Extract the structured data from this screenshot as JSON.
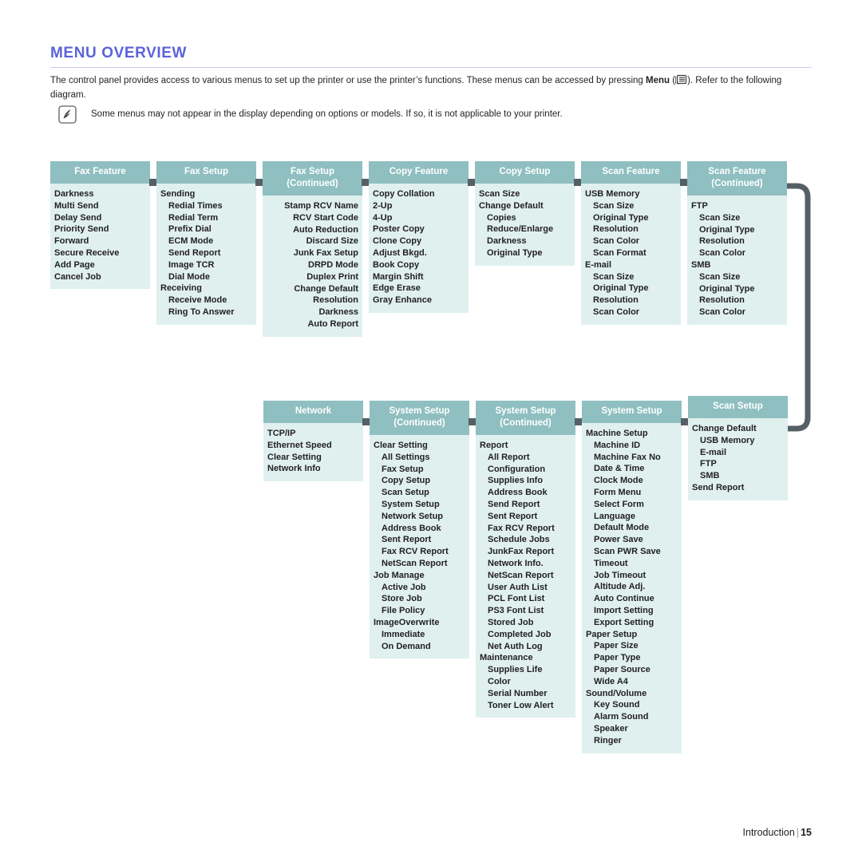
{
  "page": {
    "title": "Menu Overview",
    "intro_part1": "The control panel provides access to various menus to set up the printer or use the printer’s functions. These menus can be accessed by pressing ",
    "intro_bold": "Menu",
    "intro_part2": " (",
    "intro_part3": "). Refer to the following diagram.",
    "note_text": "Some menus may not appear in the display depending on options or models. If so, it is not applicable to your printer.",
    "note_icon": "note-pencil-icon",
    "menu_icon": "menu-key-icon",
    "footer_label": "Introduction",
    "footer_separator": "|",
    "footer_page": "15"
  },
  "colors": {
    "header_teal": "#8fbfc0",
    "body_mint": "#dff0ef",
    "connector_gray": "#556066",
    "title_blue": "#5b63d8"
  },
  "diagram": {
    "row1": [
      {
        "title": "Fax Feature",
        "subtitle": "",
        "align": "left",
        "items": [
          {
            "label": "Darkness",
            "level": 1
          },
          {
            "label": "Multi Send",
            "level": 1
          },
          {
            "label": "Delay Send",
            "level": 1
          },
          {
            "label": "Priority Send",
            "level": 1
          },
          {
            "label": "Forward",
            "level": 1
          },
          {
            "label": "Secure Receive",
            "level": 1
          },
          {
            "label": "Add Page",
            "level": 1
          },
          {
            "label": "Cancel Job",
            "level": 1
          }
        ]
      },
      {
        "title": "Fax Setup",
        "subtitle": "",
        "align": "left",
        "items": [
          {
            "label": "Sending",
            "level": 1
          },
          {
            "label": "Redial Times",
            "level": 2
          },
          {
            "label": "Redial Term",
            "level": 2
          },
          {
            "label": "Prefix Dial",
            "level": 2
          },
          {
            "label": "ECM Mode",
            "level": 2
          },
          {
            "label": "Send Report",
            "level": 2
          },
          {
            "label": "Image TCR",
            "level": 2
          },
          {
            "label": "Dial Mode",
            "level": 2
          },
          {
            "label": "Receiving",
            "level": 1
          },
          {
            "label": "Receive Mode",
            "level": 2
          },
          {
            "label": "Ring To Answer",
            "level": 2
          }
        ]
      },
      {
        "title": "Fax Setup",
        "subtitle": "(Continued)",
        "align": "right",
        "items": [
          {
            "label": "Stamp RCV Name",
            "level": 2
          },
          {
            "label": "RCV Start Code",
            "level": 2
          },
          {
            "label": "Auto Reduction",
            "level": 2
          },
          {
            "label": "Discard Size",
            "level": 2
          },
          {
            "label": "Junk Fax Setup",
            "level": 2
          },
          {
            "label": "DRPD Mode",
            "level": 2
          },
          {
            "label": "Duplex Print",
            "level": 2
          },
          {
            "label": "Change Default",
            "level": 1
          },
          {
            "label": "Resolution",
            "level": 2
          },
          {
            "label": "Darkness",
            "level": 2
          },
          {
            "label": "Auto Report",
            "level": 1
          }
        ]
      },
      {
        "title": "Copy Feature",
        "subtitle": "",
        "align": "left",
        "items": [
          {
            "label": "Copy Collation",
            "level": 1
          },
          {
            "label": "2-Up",
            "level": 1
          },
          {
            "label": "4-Up",
            "level": 1
          },
          {
            "label": "Poster Copy",
            "level": 1
          },
          {
            "label": "Clone Copy",
            "level": 1
          },
          {
            "label": "Adjust Bkgd.",
            "level": 1
          },
          {
            "label": "Book Copy",
            "level": 1
          },
          {
            "label": "Margin Shift",
            "level": 1
          },
          {
            "label": "Edge Erase",
            "level": 1
          },
          {
            "label": "Gray Enhance",
            "level": 1
          }
        ]
      },
      {
        "title": "Copy Setup",
        "subtitle": "",
        "align": "left",
        "items": [
          {
            "label": "Scan Size",
            "level": 1
          },
          {
            "label": "Change Default",
            "level": 1
          },
          {
            "label": "Copies",
            "level": 2
          },
          {
            "label": "Reduce/Enlarge",
            "level": 2
          },
          {
            "label": "Darkness",
            "level": 2
          },
          {
            "label": "Original Type",
            "level": 2
          }
        ]
      },
      {
        "title": "Scan Feature",
        "subtitle": "",
        "align": "left",
        "items": [
          {
            "label": "USB Memory",
            "level": 1
          },
          {
            "label": "Scan Size",
            "level": 2
          },
          {
            "label": "Original Type",
            "level": 2
          },
          {
            "label": "Resolution",
            "level": 2
          },
          {
            "label": "Scan Color",
            "level": 2
          },
          {
            "label": "Scan Format",
            "level": 2
          },
          {
            "label": "E-mail",
            "level": 1
          },
          {
            "label": "Scan Size",
            "level": 2
          },
          {
            "label": "Original Type",
            "level": 2
          },
          {
            "label": "Resolution",
            "level": 2
          },
          {
            "label": "Scan Color",
            "level": 2
          }
        ]
      },
      {
        "title": "Scan Feature",
        "subtitle": "(Continued)",
        "align": "left",
        "items": [
          {
            "label": "FTP",
            "level": 1
          },
          {
            "label": "Scan Size",
            "level": 2
          },
          {
            "label": "Original Type",
            "level": 2
          },
          {
            "label": "Resolution",
            "level": 2
          },
          {
            "label": "Scan Color",
            "level": 2
          },
          {
            "label": "SMB",
            "level": 1
          },
          {
            "label": "Scan Size",
            "level": 2
          },
          {
            "label": "Original Type",
            "level": 2
          },
          {
            "label": "Resolution",
            "level": 2
          },
          {
            "label": "Scan Color",
            "level": 2
          }
        ]
      }
    ],
    "row2": [
      {
        "title": "Network",
        "subtitle": "",
        "align": "left",
        "items": [
          {
            "label": "TCP/IP",
            "level": 1
          },
          {
            "label": "Ethernet Speed",
            "level": 1
          },
          {
            "label": "Clear Setting",
            "level": 1
          },
          {
            "label": "Network Info",
            "level": 1
          }
        ]
      },
      {
        "title": "System Setup",
        "subtitle": "(Continued)",
        "align": "left",
        "items": [
          {
            "label": "Clear Setting",
            "level": 1
          },
          {
            "label": "All Settings",
            "level": 2
          },
          {
            "label": "Fax Setup",
            "level": 2
          },
          {
            "label": "Copy Setup",
            "level": 2
          },
          {
            "label": "Scan Setup",
            "level": 2
          },
          {
            "label": "System Setup",
            "level": 2
          },
          {
            "label": "Network Setup",
            "level": 2
          },
          {
            "label": "Address Book",
            "level": 2
          },
          {
            "label": "Sent Report",
            "level": 2
          },
          {
            "label": "Fax RCV Report",
            "level": 2
          },
          {
            "label": "NetScan Report",
            "level": 2
          },
          {
            "label": "Job Manage",
            "level": 1
          },
          {
            "label": "Active Job",
            "level": 2
          },
          {
            "label": "Store Job",
            "level": 2
          },
          {
            "label": "File Policy",
            "level": 2
          },
          {
            "label": "ImageOverwrite",
            "level": 1
          },
          {
            "label": "Immediate",
            "level": 2
          },
          {
            "label": "On Demand",
            "level": 2
          }
        ]
      },
      {
        "title": "System Setup",
        "subtitle": "(Continued)",
        "align": "left",
        "items": [
          {
            "label": "Report",
            "level": 1
          },
          {
            "label": "All Report",
            "level": 2
          },
          {
            "label": "Configuration",
            "level": 2
          },
          {
            "label": "Supplies Info",
            "level": 2
          },
          {
            "label": "Address Book",
            "level": 2
          },
          {
            "label": "Send Report",
            "level": 2
          },
          {
            "label": "Sent Report",
            "level": 2
          },
          {
            "label": "Fax RCV Report",
            "level": 2
          },
          {
            "label": "Schedule Jobs",
            "level": 2
          },
          {
            "label": "JunkFax Report",
            "level": 2
          },
          {
            "label": "Network Info.",
            "level": 2
          },
          {
            "label": "NetScan Report",
            "level": 2
          },
          {
            "label": "User Auth List",
            "level": 2
          },
          {
            "label": "PCL Font List",
            "level": 2
          },
          {
            "label": "PS3 Font List",
            "level": 2
          },
          {
            "label": "Stored Job",
            "level": 2
          },
          {
            "label": "Completed Job",
            "level": 2
          },
          {
            "label": "Net Auth Log",
            "level": 2
          },
          {
            "label": "Maintenance",
            "level": 1
          },
          {
            "label": "Supplies Life",
            "level": 2
          },
          {
            "label": "Color",
            "level": 2
          },
          {
            "label": "Serial Number",
            "level": 2
          },
          {
            "label": "Toner Low Alert",
            "level": 2
          }
        ]
      },
      {
        "title": "System Setup",
        "subtitle": "",
        "align": "left",
        "items": [
          {
            "label": "Machine Setup",
            "level": 1
          },
          {
            "label": "Machine ID",
            "level": 2
          },
          {
            "label": "Machine Fax No",
            "level": 2
          },
          {
            "label": "Date & Time",
            "level": 2
          },
          {
            "label": "Clock Mode",
            "level": 2
          },
          {
            "label": "Form Menu",
            "level": 2
          },
          {
            "label": "Select Form",
            "level": 2
          },
          {
            "label": "Language",
            "level": 2
          },
          {
            "label": "Default Mode",
            "level": 2
          },
          {
            "label": "Power Save",
            "level": 2
          },
          {
            "label": "Scan PWR Save",
            "level": 2
          },
          {
            "label": "Timeout",
            "level": 2
          },
          {
            "label": "Job Timeout",
            "level": 2
          },
          {
            "label": "Altitude Adj.",
            "level": 2
          },
          {
            "label": "Auto Continue",
            "level": 2
          },
          {
            "label": "Import Setting",
            "level": 2
          },
          {
            "label": "Export Setting",
            "level": 2
          },
          {
            "label": "Paper Setup",
            "level": 1
          },
          {
            "label": "Paper Size",
            "level": 2
          },
          {
            "label": "Paper Type",
            "level": 2
          },
          {
            "label": "Paper Source",
            "level": 2
          },
          {
            "label": "Wide A4",
            "level": 2
          },
          {
            "label": "Sound/Volume",
            "level": 1
          },
          {
            "label": "Key Sound",
            "level": 2
          },
          {
            "label": "Alarm Sound",
            "level": 2
          },
          {
            "label": "Speaker",
            "level": 2
          },
          {
            "label": "Ringer",
            "level": 2
          }
        ]
      },
      {
        "title": "Scan Setup",
        "subtitle": "",
        "align": "left",
        "items": [
          {
            "label": "Change Default",
            "level": 1
          },
          {
            "label": "USB Memory",
            "level": 2
          },
          {
            "label": "E-mail",
            "level": 2
          },
          {
            "label": "FTP",
            "level": 2
          },
          {
            "label": "SMB",
            "level": 2
          },
          {
            "label": "Send Report",
            "level": 1
          }
        ]
      }
    ]
  }
}
